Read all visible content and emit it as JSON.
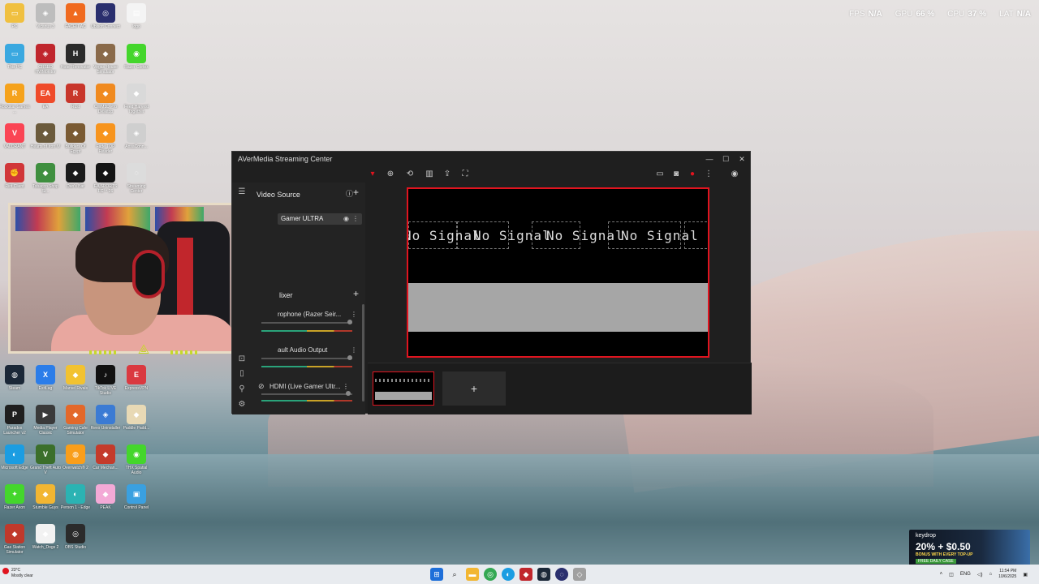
{
  "hud": {
    "fps_label": "FPS",
    "fps_value": "N/A",
    "gpu_label": "GPU",
    "gpu_value": "66 %",
    "cpu_label": "CPU",
    "cpu_value": "37 %",
    "lat_label": "LAT",
    "lat_value": "N/A"
  },
  "desktop_icons": [
    {
      "label": "PC",
      "icon": "folder-icon",
      "color": "#f0c040"
    },
    {
      "label": "Vicarius 3",
      "icon": "app-icon",
      "color": "#bdbdbd"
    },
    {
      "label": "FACEIT AC",
      "icon": "faceit-icon",
      "color": "#f06a1f"
    },
    {
      "label": "Ubisoft Connect",
      "icon": "ubisoft-icon",
      "color": "#2a2f6e"
    },
    {
      "label": "logo",
      "icon": "image-file-icon",
      "color": "#f4f4f4"
    },
    {
      "label": "This PC",
      "icon": "monitor-icon",
      "color": "#3aa8e0"
    },
    {
      "label": "CRSED HWMonitor",
      "icon": "app-icon",
      "color": "#c0262d"
    },
    {
      "label": "Hotel Renovator",
      "icon": "hotel-icon",
      "color": "#2b2b2b"
    },
    {
      "label": "Vegas House Simulator",
      "icon": "game-icon",
      "color": "#8a6a4a"
    },
    {
      "label": "Razer Cortex",
      "icon": "razer-cortex-icon",
      "color": "#44d62c"
    },
    {
      "label": "Rockstar Games ...",
      "icon": "rockstar-icon",
      "color": "#f5a21b"
    },
    {
      "label": "EA",
      "icon": "ea-icon",
      "color": "#ef4b2a"
    },
    {
      "label": "Rust",
      "icon": "rust-icon",
      "color": "#c8362b"
    },
    {
      "label": "CWM3D Pro Desktop",
      "icon": "game-icon",
      "color": "#f08a1f"
    },
    {
      "label": "Feed Harvest Together",
      "icon": "game-icon",
      "color": "#d9d9d9"
    },
    {
      "label": "VALORANT",
      "icon": "valorant-icon",
      "color": "#fa4454"
    },
    {
      "label": "Hearts of Iron IV",
      "icon": "game-icon",
      "color": "#6b5a3c"
    },
    {
      "label": "Builders Of Egypt",
      "icon": "game-icon",
      "color": "#7a5a33"
    },
    {
      "label": "Fade TOP Reader",
      "icon": "game-icon",
      "color": "#f7941d"
    },
    {
      "label": "AnsaConn...",
      "icon": "app-icon",
      "color": "#cfcfcf"
    },
    {
      "label": "Riot Client",
      "icon": "riot-icon",
      "color": "#d13639"
    },
    {
      "label": "Tobacco Shop Si...",
      "icon": "game-icon",
      "color": "#3f8f3f"
    },
    {
      "label": "Dan's Bar",
      "icon": "game-icon",
      "color": "#1b1b1b"
    },
    {
      "label": "EA SPORTS FC™ 26",
      "icon": "game-icon",
      "color": "#141414"
    },
    {
      "label": "Streaming Center",
      "icon": "avermedia-icon",
      "color": "#dcdcdc"
    },
    {
      "label": "Steam",
      "icon": "steam-icon",
      "color": "#1b2838"
    },
    {
      "label": "ExitLag",
      "icon": "exitlag-icon",
      "color": "#2b7de9"
    },
    {
      "label": "Marvel Rivals",
      "icon": "game-icon",
      "color": "#f2c230"
    },
    {
      "label": "TikTok LIVE Studio",
      "icon": "tiktok-icon",
      "color": "#111111"
    },
    {
      "label": "ExpressVPN",
      "icon": "expressvpn-icon",
      "color": "#da3940"
    },
    {
      "label": "Paradox Launcher v2",
      "icon": "paradox-icon",
      "color": "#1f1f1f"
    },
    {
      "label": "Media Player Classic",
      "icon": "media-player-icon",
      "color": "#3a3a3a"
    },
    {
      "label": "Gaming Cafe Simulator",
      "icon": "game-icon",
      "color": "#e3682a"
    },
    {
      "label": "Revo Uninstaller",
      "icon": "app-icon",
      "color": "#3b7bd4"
    },
    {
      "label": "Paddle Padd...",
      "icon": "game-icon",
      "color": "#e8d9b5"
    },
    {
      "label": "Microsoft Edge",
      "icon": "edge-icon",
      "color": "#1b9de2"
    },
    {
      "label": "Grand Theft Auto V",
      "icon": "gta-icon",
      "color": "#3b6f2b"
    },
    {
      "label": "Overwatch® 2",
      "icon": "overwatch-icon",
      "color": "#f99e1a"
    },
    {
      "label": "Car Mechan...",
      "icon": "game-icon",
      "color": "#c43b2b"
    },
    {
      "label": "THX Spatial Audio",
      "icon": "thx-icon",
      "color": "#44d62c"
    },
    {
      "label": "Razer Axon",
      "icon": "razer-axon-icon",
      "color": "#44d62c"
    },
    {
      "label": "Stumble Guys",
      "icon": "game-icon",
      "color": "#f2b632"
    },
    {
      "label": "Person 1 - Edge",
      "icon": "edge-icon",
      "color": "#2bb3b3"
    },
    {
      "label": "PEAK",
      "icon": "game-icon",
      "color": "#f3a9d6"
    },
    {
      "label": "Control Panel",
      "icon": "control-panel-icon",
      "color": "#3aa0e0"
    },
    {
      "label": "Gas Station Simulator",
      "icon": "game-icon",
      "color": "#c0392b"
    },
    {
      "label": "Watch_Dogs 2",
      "icon": "game-icon",
      "color": "#f2f2f2"
    },
    {
      "label": "OBS Studio",
      "icon": "obs-icon",
      "color": "#2b2b2b"
    }
  ],
  "window": {
    "title": "AVerMedia Streaming Center",
    "sources_title": "Video Source",
    "source_item": "Gamer ULTRA",
    "mixer_title": "Mixer",
    "mixer_title_visible": "lixer",
    "channels": [
      "rophone (Razer Seir...",
      "ault Audio Output",
      "HDMI (Live Gamer Ultr..."
    ],
    "preview_text": "No Signal",
    "add_scene": "+"
  },
  "taskbar": {
    "temp": "23°C",
    "weather": "Mostly clear",
    "lang": "ENG",
    "time": "11:54 PM",
    "date": "10/6/2025"
  },
  "ad": {
    "brand": "keydrop",
    "promo": "20% + $0.50",
    "sub": "BONUS WITH EVERY TOP-UP",
    "free": "FREE DAILY CASE"
  }
}
